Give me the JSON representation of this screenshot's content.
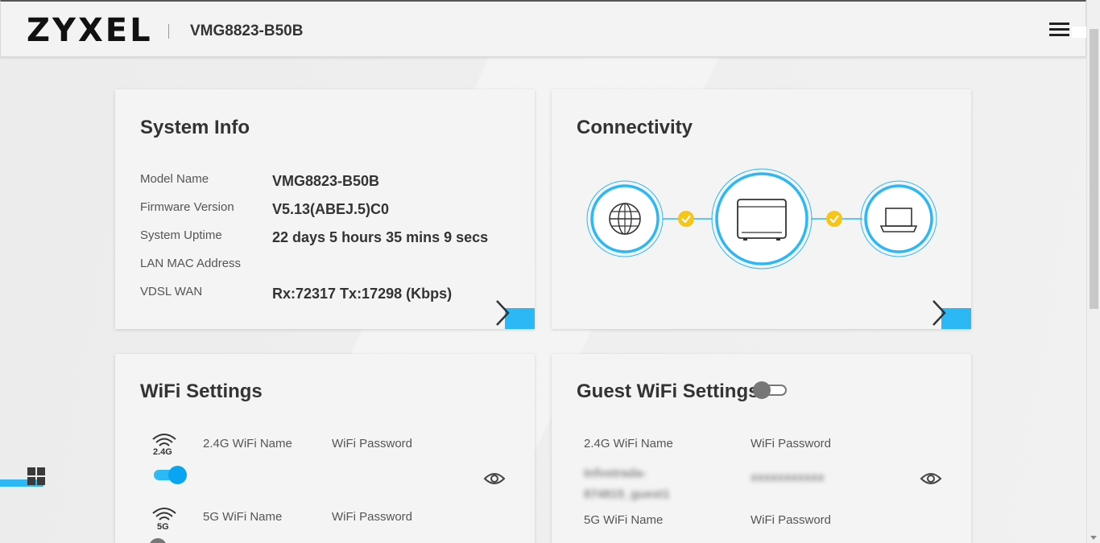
{
  "header": {
    "logo": "ZYXEL",
    "model": "VMG8823-B50B",
    "menu_icon": "hamburger-icon"
  },
  "system_info": {
    "title": "System Info",
    "rows": [
      {
        "label": "Model Name",
        "value": "VMG8823-B50B"
      },
      {
        "label": "Firmware Version",
        "value": "V5.13(ABEJ.5)C0"
      },
      {
        "label": "System Uptime",
        "value": "22 days 5 hours 35 mins 9 secs"
      },
      {
        "label": "LAN MAC Address",
        "value": ""
      },
      {
        "label": "VDSL WAN",
        "value": "Rx:72317 Tx:17298 (Kbps)"
      }
    ],
    "more_icon": "chevron-right-icon"
  },
  "connectivity": {
    "title": "Connectivity",
    "nodes": [
      "globe-icon",
      "router-icon",
      "laptop-icon"
    ],
    "status_icons": [
      "check-icon",
      "check-icon"
    ],
    "more_icon": "chevron-right-icon"
  },
  "wifi_settings": {
    "title": "WiFi Settings",
    "band_24": {
      "badge": "2.4G",
      "name_label": "2.4G WiFi Name",
      "password_label": "WiFi Password",
      "enabled": true
    },
    "band_5": {
      "badge": "5G",
      "name_label": "5G WiFi Name",
      "password_label": "WiFi Password"
    }
  },
  "guest_wifi_settings": {
    "title": "Guest WiFi Settings",
    "enabled": false,
    "band_24": {
      "name_label": "2.4G WiFi Name",
      "password_label": "WiFi Password",
      "name_value": "Infostrada-874815_guest1",
      "password_value": "xxxxxxxxxxx"
    },
    "band_5": {
      "name_label": "5G WiFi Name",
      "password_label": "WiFi Password"
    }
  },
  "colors": {
    "accent": "#2cb8f4",
    "check": "#f5c518",
    "text": "#333333"
  }
}
